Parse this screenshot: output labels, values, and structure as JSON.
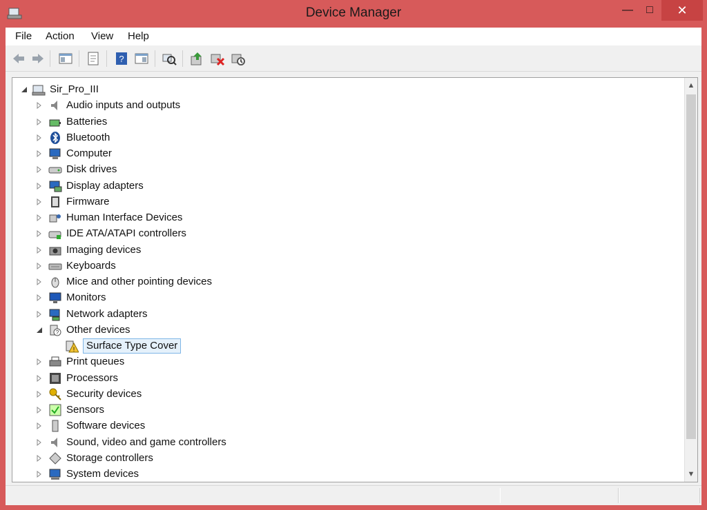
{
  "window": {
    "title": "Device Manager",
    "accent": "#d75a5a"
  },
  "menubar": {
    "items": [
      "File",
      "Action",
      "View",
      "Help"
    ]
  },
  "toolbar": {
    "icons": [
      "back-icon",
      "forward-icon",
      "properties-pane-icon",
      "properties-icon",
      "help-icon",
      "action-pane-icon",
      "scan-hardware-icon",
      "update-driver-icon",
      "uninstall-icon",
      "disable-icon"
    ]
  },
  "tree": {
    "root": "Sir_Pro_III",
    "items": [
      {
        "label": "Audio inputs and outputs",
        "icon": "speaker-icon"
      },
      {
        "label": "Batteries",
        "icon": "battery-icon"
      },
      {
        "label": "Bluetooth",
        "icon": "bluetooth-icon"
      },
      {
        "label": "Computer",
        "icon": "computer-icon"
      },
      {
        "label": "Disk drives",
        "icon": "disk-drive-icon"
      },
      {
        "label": "Display adapters",
        "icon": "display-adapter-icon"
      },
      {
        "label": "Firmware",
        "icon": "firmware-icon"
      },
      {
        "label": "Human Interface Devices",
        "icon": "hid-icon"
      },
      {
        "label": "IDE ATA/ATAPI controllers",
        "icon": "ide-controller-icon"
      },
      {
        "label": "Imaging devices",
        "icon": "camera-icon"
      },
      {
        "label": "Keyboards",
        "icon": "keyboard-icon"
      },
      {
        "label": "Mice and other pointing devices",
        "icon": "mouse-icon"
      },
      {
        "label": "Monitors",
        "icon": "monitor-icon"
      },
      {
        "label": "Network adapters",
        "icon": "network-adapter-icon"
      },
      {
        "label": "Other devices",
        "icon": "unknown-device-icon"
      },
      {
        "label": "Print queues",
        "icon": "printer-icon"
      },
      {
        "label": "Processors",
        "icon": "processor-icon"
      },
      {
        "label": "Security devices",
        "icon": "key-icon"
      },
      {
        "label": "Sensors",
        "icon": "sensor-icon"
      },
      {
        "label": "Software devices",
        "icon": "software-device-icon"
      },
      {
        "label": "Sound, video and game controllers",
        "icon": "speaker-icon"
      },
      {
        "label": "Storage controllers",
        "icon": "storage-controller-icon"
      },
      {
        "label": "System devices",
        "icon": "system-device-icon"
      }
    ],
    "child_of_other_devices": {
      "label": "Surface Type Cover",
      "icon": "warning-device-icon"
    }
  }
}
